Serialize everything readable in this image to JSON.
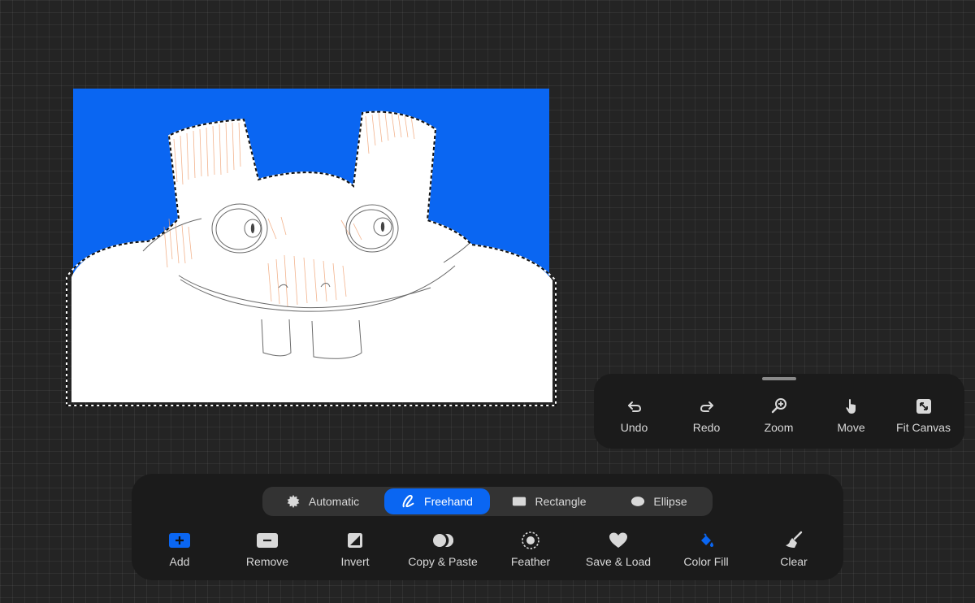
{
  "canvas": {
    "background_color": "#0a66f2",
    "subject": "white cartoon bunny creature with buck teeth, freehand selection marquee"
  },
  "quick_toolbar": {
    "items": [
      {
        "label": "Undo",
        "icon": "undo-icon"
      },
      {
        "label": "Redo",
        "icon": "redo-icon"
      },
      {
        "label": "Zoom",
        "icon": "zoom-in-icon"
      },
      {
        "label": "Move",
        "icon": "hand-icon"
      },
      {
        "label": "Fit Canvas",
        "icon": "fit-canvas-icon"
      }
    ]
  },
  "selection_modes": {
    "active": "Freehand",
    "items": [
      {
        "label": "Automatic",
        "icon": "automatic-icon"
      },
      {
        "label": "Freehand",
        "icon": "freehand-icon"
      },
      {
        "label": "Rectangle",
        "icon": "rectangle-icon"
      },
      {
        "label": "Ellipse",
        "icon": "ellipse-icon"
      }
    ]
  },
  "selection_tools": {
    "items": [
      {
        "label": "Add",
        "icon": "add-icon"
      },
      {
        "label": "Remove",
        "icon": "remove-icon"
      },
      {
        "label": "Invert",
        "icon": "invert-icon"
      },
      {
        "label": "Copy & Paste",
        "icon": "copy-paste-icon"
      },
      {
        "label": "Feather",
        "icon": "feather-icon"
      },
      {
        "label": "Save & Load",
        "icon": "heart-icon"
      },
      {
        "label": "Color Fill",
        "icon": "color-fill-icon"
      },
      {
        "label": "Clear",
        "icon": "broom-icon"
      }
    ]
  },
  "colors": {
    "accent": "#0a66f2",
    "panel": "#1b1b1b",
    "canvas_bg": "#242424",
    "sketch_orange": "#f0a070"
  }
}
